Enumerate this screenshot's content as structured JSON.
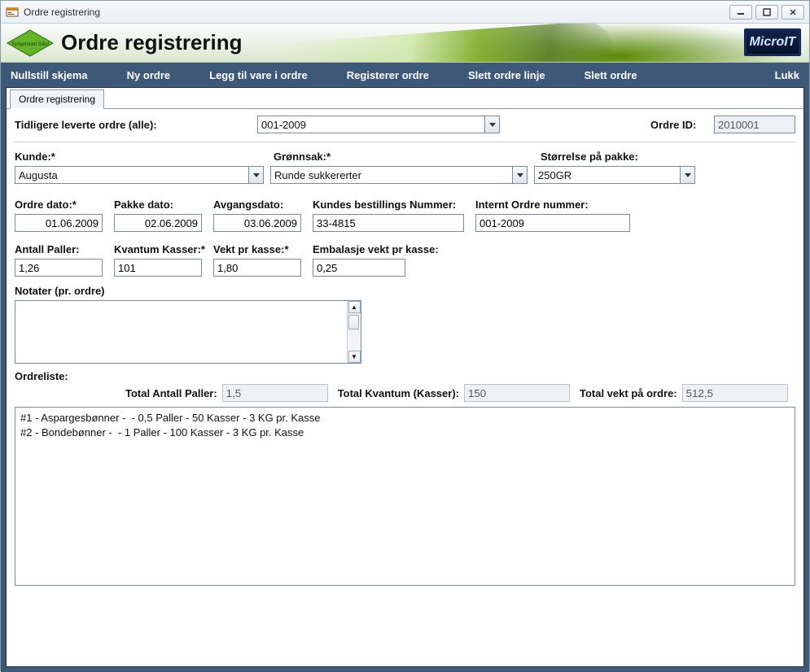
{
  "window": {
    "title": "Ordre registrering"
  },
  "banner": {
    "title": "Ordre registrering",
    "brand": "MicroIT",
    "logo_text": "Torbjørnrød Gård"
  },
  "toolbar": {
    "nullstill": "Nullstill skjema",
    "ny": "Ny ordre",
    "leggtil": "Legg til vare i ordre",
    "registrer": "Registerer ordre",
    "slettlinje": "Slett ordre linje",
    "slettordre": "Slett ordre",
    "lukk": "Lukk"
  },
  "tab": {
    "label": "Ordre registrering"
  },
  "labels": {
    "tidligere": "Tidligere leverte ordre (alle):",
    "ordreid": "Ordre ID:",
    "kunde": "Kunde:*",
    "gronnsak": "Grønnsak:*",
    "storrelse": "Størrelse på pakke:",
    "ordredato": "Ordre dato:*",
    "pakkedato": "Pakke dato:",
    "avgangsdato": "Avgangsdato:",
    "best": "Kundes bestillings Nummer:",
    "internt": "Internt Ordre nummer:",
    "paller": "Antall Paller:",
    "kvantum": "Kvantum Kasser:*",
    "vekt": "Vekt pr kasse:*",
    "embalasje": "Embalasje vekt pr kasse:",
    "notater": "Notater (pr. ordre)",
    "ordreliste": "Ordreliste:",
    "tot_paller": "Total Antall Paller:",
    "tot_kvantum": "Total Kvantum (Kasser):",
    "tot_vekt": "Total vekt på ordre:"
  },
  "values": {
    "tidligere": "001-2009",
    "ordreid": "2010001",
    "kunde": "Augusta",
    "gronnsak": "Runde sukkererter",
    "storrelse": "250GR",
    "ordredato": "01.06.2009",
    "pakkedato": "02.06.2009",
    "avgangsdato": "03.06.2009",
    "best": "33-4815",
    "internt": "001-2009",
    "paller": "1,26",
    "kvantum": "101",
    "vekt": "1,80",
    "embalasje": "0,25",
    "tot_paller": "1,5",
    "tot_kvantum": "150",
    "tot_vekt": "512,5"
  },
  "orderlist": [
    "#1 - Aspargesbønner -  - 0,5 Paller - 50 Kasser - 3 KG pr. Kasse",
    "#2 - Bondebønner -  - 1 Paller - 100 Kasser - 3 KG pr. Kasse"
  ]
}
